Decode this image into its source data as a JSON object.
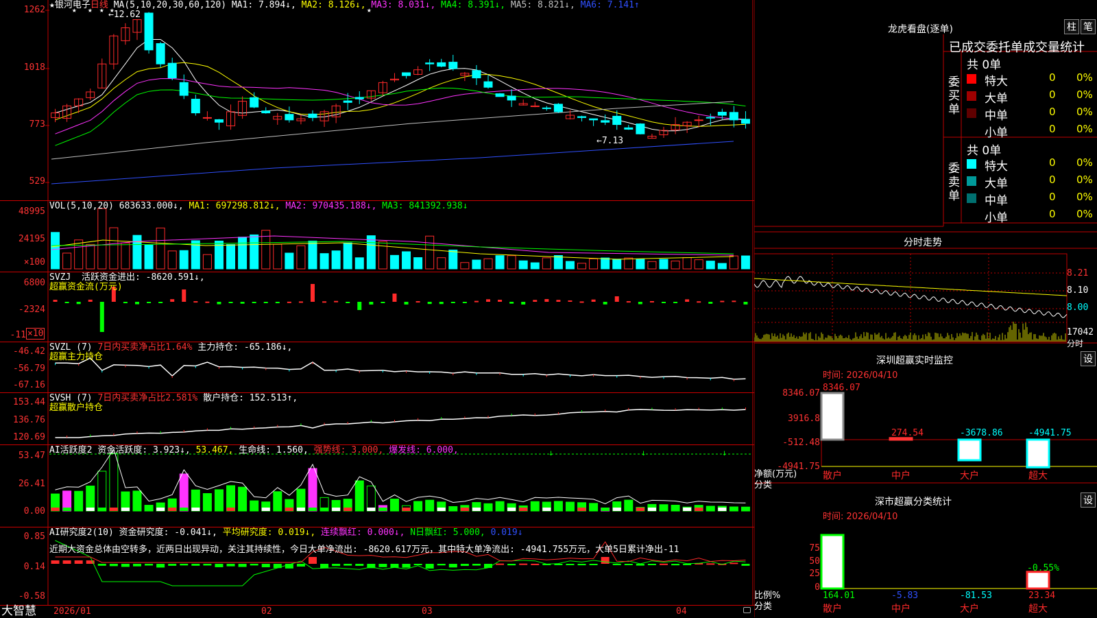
{
  "app_name": "大智慧",
  "stock": {
    "star": "★",
    "name": "银河电子",
    "period": "日线"
  },
  "colors": {
    "up": "#ff2a2a",
    "down": "#00ffff",
    "grid": "#c00000",
    "green": "#00ff00",
    "yellow": "#ffff00",
    "magenta": "#ff33ff"
  },
  "kline": {
    "ma_label": "MA(5,10,20,30,60,120)",
    "ma": [
      {
        "text": "MA1: 7.894↓,",
        "color": "#ffffff"
      },
      {
        "text": "MA2: 8.126↓,",
        "color": "#ffff00"
      },
      {
        "text": "MA3: 8.031↓,",
        "color": "#ff33ff"
      },
      {
        "text": "MA4: 8.391↓,",
        "color": "#00ff00"
      },
      {
        "text": "MA5: 8.821↓,",
        "color": "#c0c0c0"
      },
      {
        "text": "MA6: 7.141↑",
        "color": "#3050ff"
      }
    ],
    "yaxis": [
      "1262",
      "1018",
      "773",
      "529"
    ],
    "high_note": "←12.62",
    "low_note": "←7.13"
  },
  "vol": {
    "label": "VOL(5,10,20)",
    "items": [
      {
        "text": "683633.000↓,",
        "color": "#ffffff"
      },
      {
        "text": "MA1: 697298.812↓,",
        "color": "#ffff00"
      },
      {
        "text": "MA2: 970435.188↓,",
        "color": "#ff33ff"
      },
      {
        "text": "MA3: 841392.938↓",
        "color": "#00ff00"
      }
    ],
    "yaxis": [
      "48995",
      "24195",
      "×100"
    ]
  },
  "svzj": {
    "title": "SVZJ",
    "label": "活跃资金进出: -8620.591↓,",
    "sub": "超赢资金流(万元)",
    "yaxis": [
      "6800",
      "-2324",
      "-11",
      "×10"
    ]
  },
  "svzl": {
    "title": "SVZL (7)",
    "pct": "7日内买卖净占比1.64%",
    "label": "主力持仓: -65.186↓,",
    "sub": "超赢主力持仓",
    "yaxis": [
      "-46.42",
      "-56.79",
      "-67.16"
    ]
  },
  "svsh": {
    "title": "SVSH (7)",
    "pct": "7日内买卖净占比2.581%",
    "label": "散户持仓: 152.513↑,",
    "sub": "超赢散户持仓",
    "yaxis": [
      "153.44",
      "136.76",
      "120.69"
    ]
  },
  "ai": {
    "title": "AI活跃度2",
    "label": "资金活跃度: 3.923↓,",
    "v2": "53.467,",
    "life": "生命线: 1.560,",
    "strong": "强势线: 3.000,",
    "burst": "爆发线: 6.000,",
    "yaxis": [
      "53.47",
      "26.41",
      "0.00"
    ]
  },
  "air": {
    "title": "AI研究度2(10)",
    "label": "资金研究度: -0.041↓,",
    "avg": "平均研究度: 0.019↓,",
    "red": "连续飘红: 0.000↓,",
    "nred": "N日飘红: 5.000,",
    "v5": "0.019↓",
    "comment": "近期大资金总体由空转多，近两日出现异动，关注其持续性，今日大单净流出: -8620.617万元，其中特大单净流出: -4941.755万元，大单5日累计净出-11",
    "yaxis": [
      "0.85",
      "0.14",
      "-0.58"
    ]
  },
  "xaxis": [
    "2026/01",
    "02",
    "03",
    "04"
  ],
  "lhb": {
    "title": "龙虎看盘(逐单)",
    "btn1": "柱",
    "btn2": "笔",
    "heading": "已成交委托单成交量统计",
    "buy_label": "委买单",
    "sell_label": "委卖单",
    "buy_total": "共 0单",
    "sell_total": "共 0单",
    "buy": [
      {
        "name": "特大",
        "n": "0",
        "p": "0%",
        "color": "#ff0000"
      },
      {
        "name": "大单",
        "n": "0",
        "p": "0%",
        "color": "#a00000"
      },
      {
        "name": "中单",
        "n": "0",
        "p": "0%",
        "color": "#600000"
      },
      {
        "name": "小单",
        "n": "0",
        "p": "0%",
        "color": "#000000"
      }
    ],
    "sell": [
      {
        "name": "特大",
        "n": "0",
        "p": "0%",
        "color": "#00ffff"
      },
      {
        "name": "大单",
        "n": "0",
        "p": "0%",
        "color": "#009a9a"
      },
      {
        "name": "中单",
        "n": "0",
        "p": "0%",
        "color": "#007070"
      },
      {
        "name": "小单",
        "n": "0",
        "p": "0%",
        "color": "#000000"
      }
    ]
  },
  "fenshi": {
    "title": "分时走势",
    "yaxis": [
      "8.21",
      "8.10",
      "8.00"
    ],
    "vol": "17042",
    "vol_unit": "分时"
  },
  "monitor": {
    "title": "深圳超赢实时监控",
    "btn": "设",
    "time": "时间: 2026/04/10",
    "yaxis": [
      "8346.07",
      "3916.8",
      "-512.48",
      "-4941.75"
    ],
    "ylabel": "净额(万元)",
    "xlabel": "分类"
  },
  "classify": {
    "title": "深市超赢分类统计",
    "btn": "设",
    "time": "时间: 2026/04/10",
    "yaxis": [
      "75",
      "50",
      "25",
      "0"
    ],
    "ylabel": "比例%",
    "xlabel": "分类",
    "pct_note": "-0.55%"
  },
  "chart_data": [
    {
      "type": "bar",
      "title": "深圳超赢实时监控",
      "categories": [
        "散户",
        "中户",
        "大户",
        "超大"
      ],
      "values": [
        8346.07,
        274.54,
        -3678.86,
        -4941.75
      ],
      "ylabel": "净额(万元)",
      "ylim": [
        -4941.75,
        8346.07
      ]
    },
    {
      "type": "bar",
      "title": "深市超赢分类统计",
      "categories": [
        "散户",
        "中户",
        "大户",
        "超大"
      ],
      "values": [
        164.01,
        -5.83,
        -81.53,
        23.34
      ],
      "ylabel": "比例%",
      "ylim": [
        0,
        75
      ]
    }
  ]
}
